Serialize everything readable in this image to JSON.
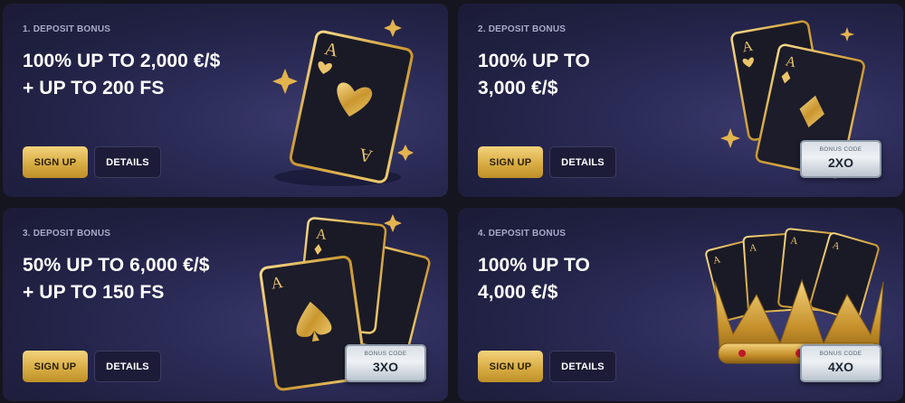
{
  "colors": {
    "card_bg": "#2a2a55",
    "page_bg": "#15151f",
    "gold": "#d8ad44",
    "text_white": "#ffffff",
    "eyebrow": "#a9a9c8"
  },
  "cards": [
    {
      "eyebrow": "1. DEPOSIT BONUS",
      "headline_line1": "100% UP TO 2,000 €/$",
      "headline_line2": "+ UP TO 200 FS",
      "signup_label": "SIGN UP",
      "details_label": "DETAILS",
      "artwork": "ace-of-hearts-card-icon"
    },
    {
      "eyebrow": "2. DEPOSIT BONUS",
      "headline_line1": "100% UP TO",
      "headline_line2": "3,000 €/$",
      "signup_label": "SIGN UP",
      "details_label": "DETAILS",
      "artwork": "ace-of-hearts-and-diamonds-cards-icon",
      "bonus_code_label": "BONUS CODE",
      "bonus_code": "2XO"
    },
    {
      "eyebrow": "3. DEPOSIT BONUS",
      "headline_line1": "50% UP TO 6,000 €/$",
      "headline_line2": "+ UP TO 150 FS",
      "signup_label": "SIGN UP",
      "details_label": "DETAILS",
      "artwork": "three-aces-cards-icon",
      "bonus_code_label": "BONUS CODE",
      "bonus_code": "3XO"
    },
    {
      "eyebrow": "4. DEPOSIT BONUS",
      "headline_line1": "100% UP TO",
      "headline_line2": "4,000 €/$",
      "signup_label": "SIGN UP",
      "details_label": "DETAILS",
      "artwork": "four-aces-crown-icon",
      "bonus_code_label": "BONUS CODE",
      "bonus_code": "4XO"
    }
  ]
}
